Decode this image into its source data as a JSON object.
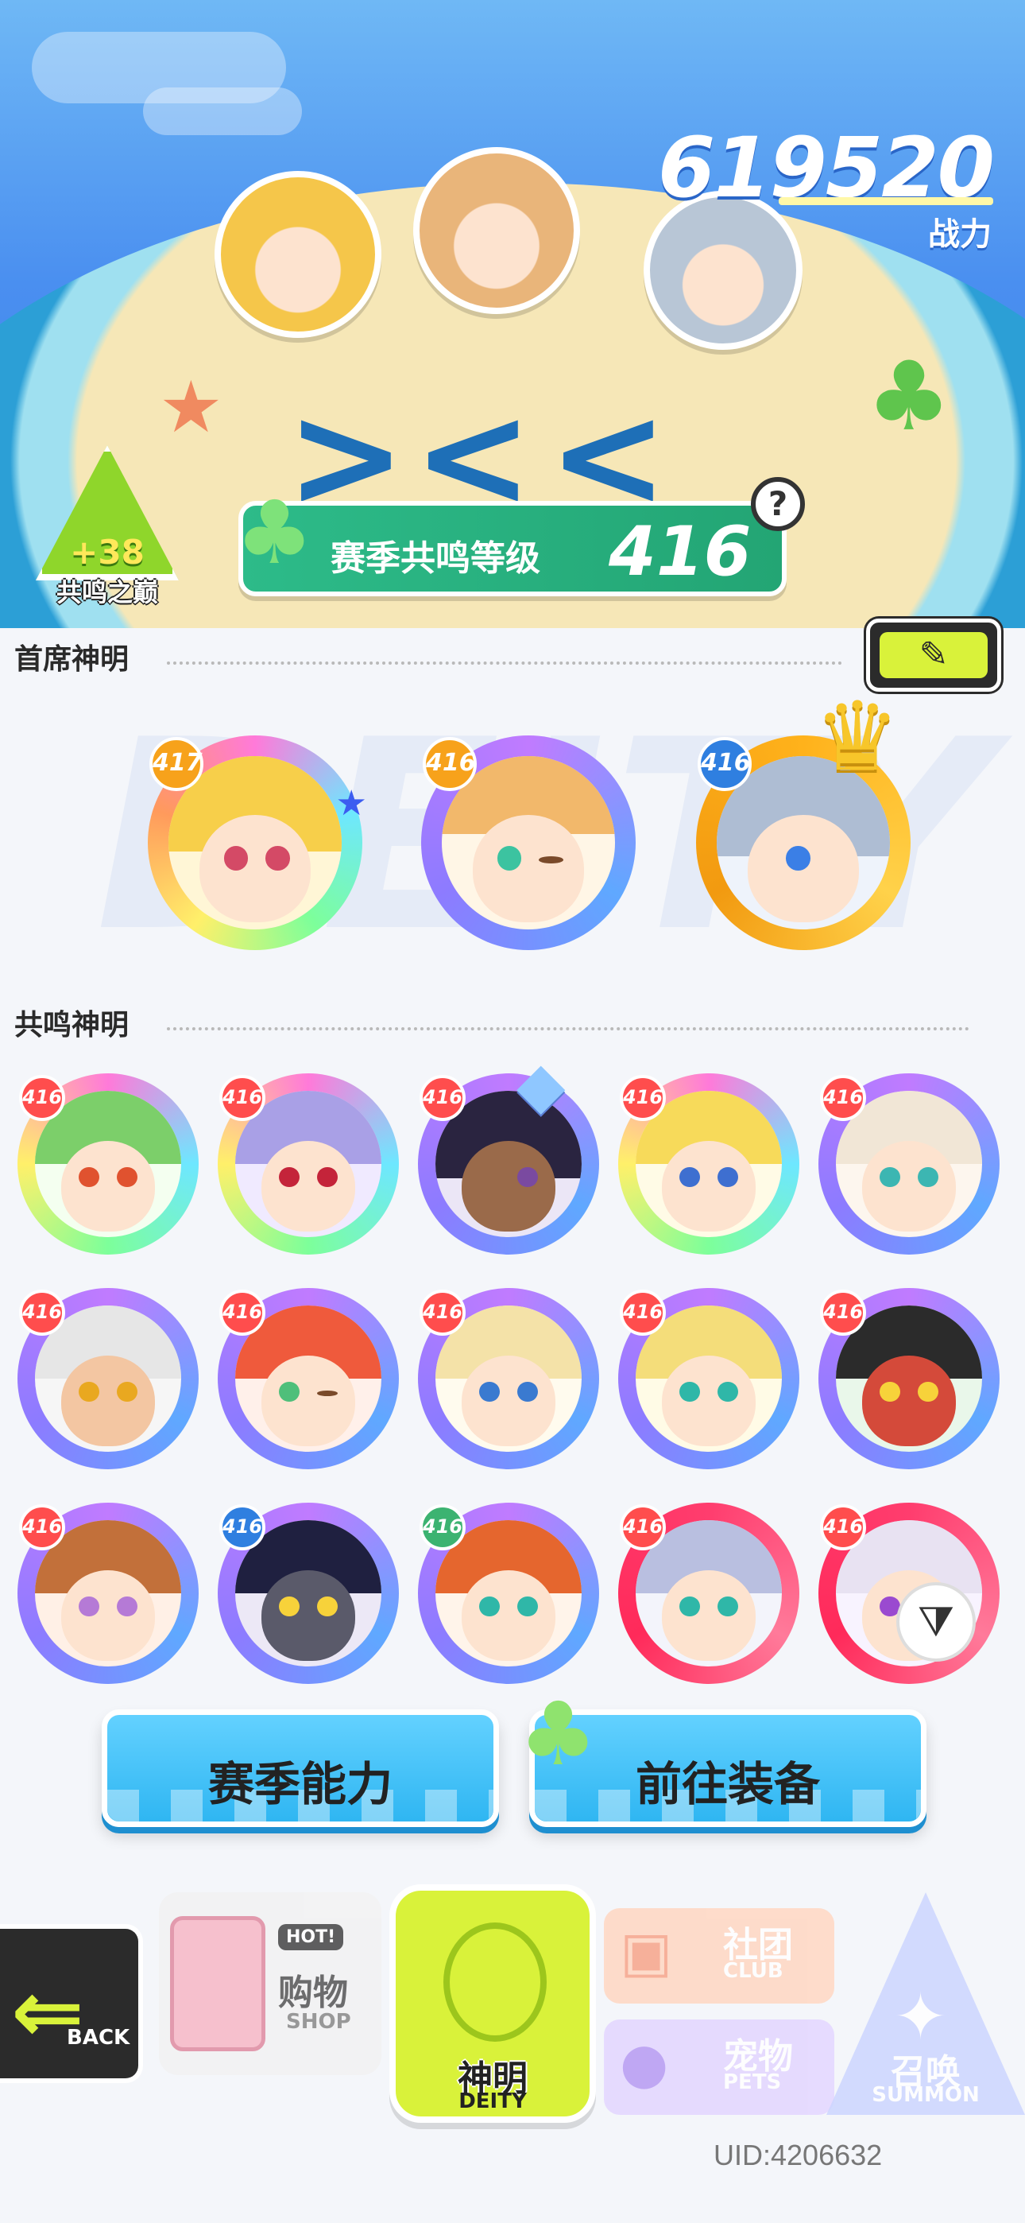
{
  "header": {
    "power_value": "619520",
    "power_label": "战力"
  },
  "peak_badge": {
    "bonus": "+38",
    "name": "共鸣之巅"
  },
  "resonance": {
    "label": "赛季共鸣等级",
    "level": "416",
    "help": "?"
  },
  "sections": {
    "leaders_title": "首席神明",
    "resonators_title": "共鸣神明",
    "watermark": "DEITY"
  },
  "edit_icon": "pencil-icon",
  "leaders": [
    {
      "level": "417"
    },
    {
      "level": "416"
    },
    {
      "level": "416"
    }
  ],
  "resonators": [
    {
      "level": "416"
    },
    {
      "level": "416"
    },
    {
      "level": "416"
    },
    {
      "level": "416"
    },
    {
      "level": "416"
    },
    {
      "level": "416"
    },
    {
      "level": "416"
    },
    {
      "level": "416"
    },
    {
      "level": "416"
    },
    {
      "level": "416"
    },
    {
      "level": "416"
    },
    {
      "level": "416"
    },
    {
      "level": "416"
    },
    {
      "level": "416"
    },
    {
      "level": "416"
    }
  ],
  "actions": {
    "season_ability": "赛季能力",
    "go_equipment": "前往装备"
  },
  "nav": {
    "back": "BACK",
    "shop_hot": "HOT!",
    "shop_cn": "购物",
    "shop_en": "SHOP",
    "deity_cn": "神明",
    "deity_en": "DEITY",
    "club_cn": "社团",
    "club_en": "CLUB",
    "pets_cn": "宠物",
    "pets_en": "PETS",
    "summon_cn": "召唤",
    "summon_en": "SUMMON"
  },
  "uid": "UID:4206632",
  "colors": {
    "accent_green": "#2dbb89",
    "lime": "#d9f23a",
    "sky": "#4a8ff0",
    "button_blue": "#2fb6f2"
  }
}
